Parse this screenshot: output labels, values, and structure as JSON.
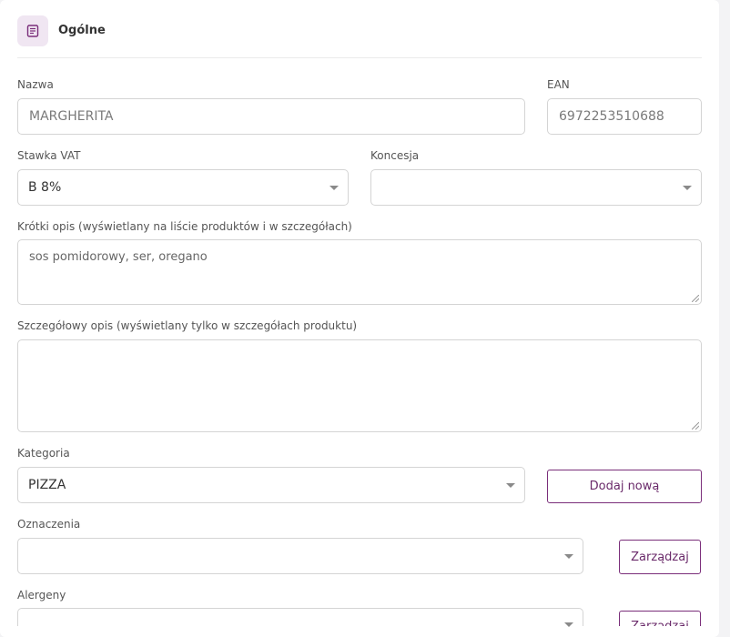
{
  "section": {
    "title": "Ogólne",
    "icon": "document-icon"
  },
  "fields": {
    "name": {
      "label": "Nazwa",
      "value": "MARGHERITA"
    },
    "ean": {
      "label": "EAN",
      "value": "6972253510688"
    },
    "vat": {
      "label": "Stawka VAT",
      "value": "B 8%"
    },
    "concession": {
      "label": "Koncesja",
      "value": ""
    },
    "short_desc": {
      "label": "Krótki opis (wyświetlany na liście produktów i w szczegółach)",
      "value": "sos pomidorowy, ser, oregano"
    },
    "long_desc": {
      "label": "Szczegółowy opis (wyświetlany tylko w szczegółach produktu)",
      "value": ""
    },
    "category": {
      "label": "Kategoria",
      "value": "PIZZA",
      "button": "Dodaj nową"
    },
    "tags": {
      "label": "Oznaczenia",
      "value": "",
      "button": "Zarządzaj"
    },
    "allergens": {
      "label": "Alergeny",
      "value": "",
      "button": "Zarządzaj"
    }
  },
  "colors": {
    "accent": "#6a2a6a",
    "icon_bg": "#f0e6f2"
  }
}
